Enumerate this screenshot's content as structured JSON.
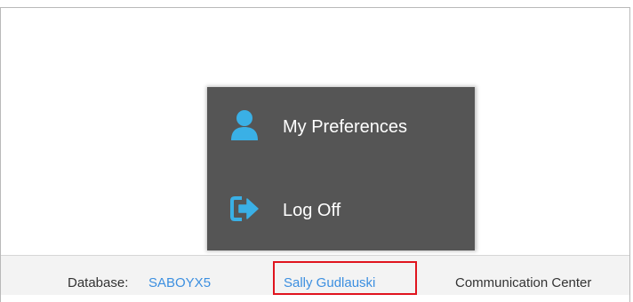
{
  "menu": {
    "items": [
      {
        "label": "My Preferences",
        "icon": "user-icon"
      },
      {
        "label": "Log Off",
        "icon": "logoff-icon"
      }
    ]
  },
  "status_bar": {
    "database_label": "Database:",
    "database_value": "SABOYX5",
    "user_name": "Sally Gudlauski",
    "communication_center": "Communication Center"
  },
  "colors": {
    "menu_background": "#555555",
    "icon_blue": "#3ab0e6",
    "link_blue": "#3c8fe0",
    "highlight_red": "#e0141e"
  }
}
